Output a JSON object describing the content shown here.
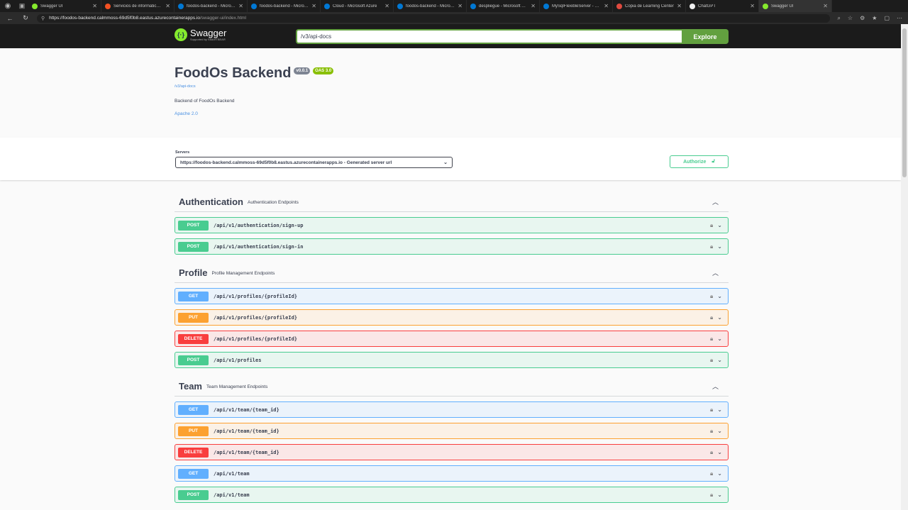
{
  "browser": {
    "tabs": [
      {
        "label": "Swagger UI",
        "color": "#85ea2d"
      },
      {
        "label": "Servicios de informática en la nube",
        "color": "#f25022"
      },
      {
        "label": "foodos-backend - Microsoft Azure",
        "color": "#0078d4"
      },
      {
        "label": "foodos-backend - Microsoft Azure",
        "color": "#0078d4"
      },
      {
        "label": "Cloud - Microsoft Azure",
        "color": "#0078d4"
      },
      {
        "label": "foodos-backend - Microsoft Azure",
        "color": "#0078d4"
      },
      {
        "label": "despliegue - Microsoft Azure",
        "color": "#0078d4"
      },
      {
        "label": "MySqlFlexibleServer - Microsoft",
        "color": "#0078d4"
      },
      {
        "label": "Copia de Learning Center",
        "color": "#e04a3f"
      },
      {
        "label": "ChatGPT",
        "color": "#eeeeee"
      },
      {
        "label": "Swagger UI",
        "color": "#85ea2d"
      }
    ],
    "url_host": "https://foodos-backend.calmmoss-69d5f0b8.eastus.azurecontainerapps.io",
    "url_path": "/swagger-ui/index.html"
  },
  "topbar": {
    "logo_name": "Swagger",
    "logo_sub": "Supported by SMARTBEAR",
    "explore_value": "/v3/api-docs",
    "explore_label": "Explore"
  },
  "info": {
    "title": "FoodOs Backend",
    "version": "v0.0.1",
    "oas": "OAS 3.0",
    "docs_link": "/v3/api-docs",
    "description": "Backend of FoodOs Backend",
    "license": "Apache 2.0"
  },
  "servers": {
    "label": "Servers",
    "selected": "https://foodos-backend.calmmoss-69d5f0b8.eastus.azurecontainerapps.io - Generated server url",
    "authorize_label": "Authorize"
  },
  "tags": [
    {
      "name": "Authentication",
      "description": "Authentication Endpoints",
      "operations": [
        {
          "method": "POST",
          "path": "/api/v1/authentication/sign-up"
        },
        {
          "method": "POST",
          "path": "/api/v1/authentication/sign-in"
        }
      ]
    },
    {
      "name": "Profile",
      "description": "Profile Management Endpoints",
      "operations": [
        {
          "method": "GET",
          "path": "/api/v1/profiles/{profileId}"
        },
        {
          "method": "PUT",
          "path": "/api/v1/profiles/{profileId}"
        },
        {
          "method": "DELETE",
          "path": "/api/v1/profiles/{profileId}"
        },
        {
          "method": "POST",
          "path": "/api/v1/profiles"
        }
      ]
    },
    {
      "name": "Team",
      "description": "Team Management Endpoints",
      "operations": [
        {
          "method": "GET",
          "path": "/api/v1/team/{team_id}"
        },
        {
          "method": "PUT",
          "path": "/api/v1/team/{team_id}"
        },
        {
          "method": "DELETE",
          "path": "/api/v1/team/{team_id}"
        },
        {
          "method": "GET",
          "path": "/api/v1/team"
        },
        {
          "method": "POST",
          "path": "/api/v1/team"
        }
      ]
    }
  ]
}
